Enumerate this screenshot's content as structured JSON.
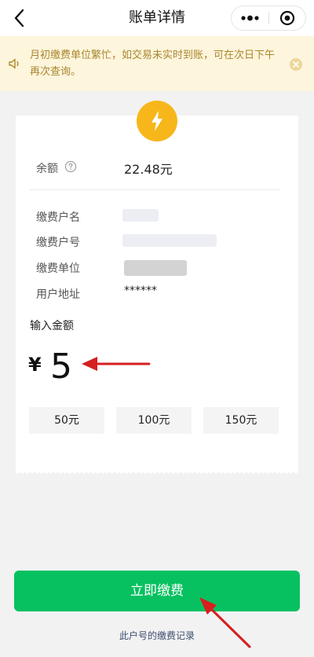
{
  "header": {
    "title": "账单详情",
    "back_icon": "chevron-left-icon",
    "more_icon": "more-dots-icon",
    "close_icon": "target-close-icon"
  },
  "notice": {
    "text": "月初缴费单位繁忙，如交易未实时到账，可在次日下午再次查询。",
    "icon": "speaker-icon",
    "close_icon": "close-circle-icon"
  },
  "bill": {
    "icon": "lightning-icon",
    "balance_label": "余额",
    "balance_value": "22.48元",
    "account_name_label": "缴费户名",
    "account_no_label": "缴费户号",
    "company_label": "缴费单位",
    "address_label": "用户地址",
    "address_value": "******"
  },
  "amount": {
    "label": "输入金额",
    "currency": "¥",
    "value": "5"
  },
  "quick_amounts": [
    "50元",
    "100元",
    "150元"
  ],
  "footer": {
    "pay_label": "立即缴费",
    "record_link": "此户号的缴费记录"
  },
  "colors": {
    "primary": "#07c160",
    "notice_bg": "#fdf5dc",
    "notice_text": "#a9862e",
    "bolt": "#f7b61a",
    "annotation_arrow": "#d61f1f"
  }
}
